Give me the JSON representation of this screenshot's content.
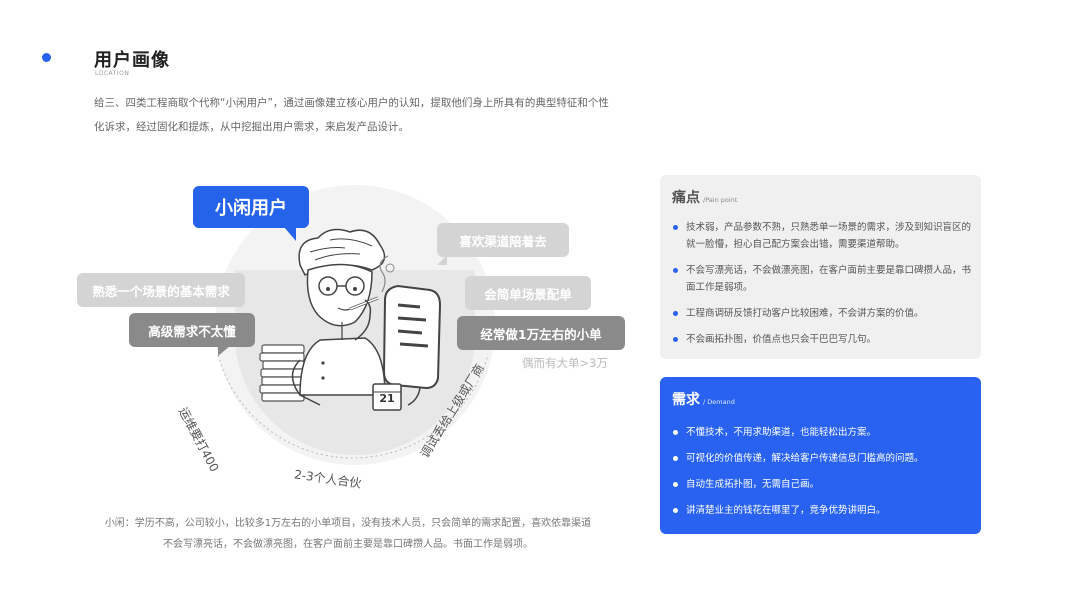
{
  "header": {
    "title": "用户画像",
    "subtitle": "LOCATION",
    "intro": "给三、四类工程商取个代称“小闲用户”，通过画像建立核心用户的认知，提取他们身上所具有的典型特征和个性化诉求，经过固化和提炼，从中挖掘出用户需求，来启发产品设计。"
  },
  "illustration": {
    "main_bubble": "小闲用户",
    "bubbles_left": [
      "熟悉一个场景的基本需求",
      "高级需求不太懂"
    ],
    "bubbles_right": [
      "喜欢渠道陪着去",
      "会简单场景配单",
      "经常做1万左右的小单"
    ],
    "faint_note": "偶而有大单>3万",
    "arc_left": "运维要打400",
    "arc_bottom": "2-3个人合伙",
    "arc_right": "调试丢给上级或厂商",
    "calendar_day": "21",
    "caption_lines": [
      "小闲：学历不高，公司较小，比较多1万左右的小单项目，没有技术人员，只会简单的需求配置，喜欢依靠渠道",
      "不会写漂亮话，不会做漂亮图，在客户面前主要是靠口碑攒人品。书面工作是弱项。"
    ]
  },
  "pain_card": {
    "title": "痛点",
    "title_en": "/Pain point",
    "items": [
      "技术弱，产品参数不熟，只熟悉单一场景的需求，涉及到知识盲区的就一脸懵，担心自己配方案会出错，需要渠道帮助。",
      "不会写漂亮话，不会做漂亮图，在客户面前主要是靠口碑攒人品，书面工作是弱项。",
      "工程商调研反馈打动客户比较困难，不会讲方案的价值。",
      "不会画拓扑图，价值点也只会干巴巴写几句。"
    ]
  },
  "demand_card": {
    "title": "需求",
    "title_en": "/ Demand",
    "items": [
      "不懂技术，不用求助渠道，也能轻松出方案。",
      "可视化的价值传递，解决给客户传递信息门槛高的问题。",
      "自动生成拓扑图，无需自己画。",
      "讲清楚业主的钱花在哪里了，竞争优势讲明白。"
    ]
  },
  "colors": {
    "accent": "#2962f0",
    "bubble_blue": "#2563eb",
    "bubble_dark": "#8a8a8a",
    "bubble_light": "#d4d4d4"
  }
}
